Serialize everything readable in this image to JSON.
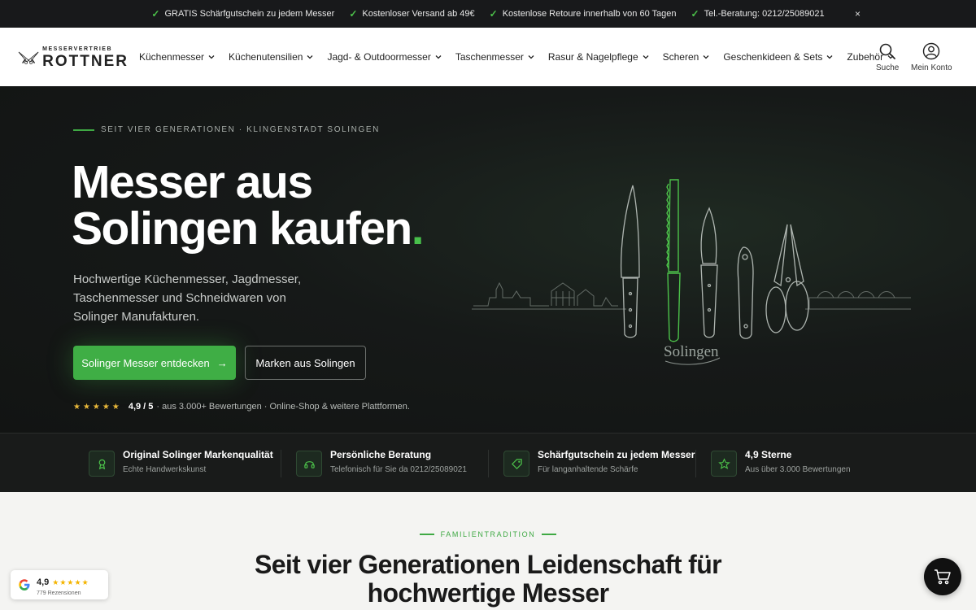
{
  "topbar": {
    "items": [
      "GRATIS Schärfgutschein zu jedem Messer",
      "Kostenloser Versand ab 49€",
      "Kostenlose Retoure innerhalb von 60 Tagen",
      "Tel.-Beratung: 0212/25089021"
    ],
    "close_label": "×"
  },
  "logo": {
    "small": "MESSERVERTRIEB",
    "big": "ROTTNER"
  },
  "nav": [
    "Küchenmesser",
    "Küchenutensilien",
    "Jagd- & Outdoormesser",
    "Taschenmesser",
    "Rasur & Nagelpflege",
    "Scheren",
    "Geschenkideen & Sets",
    "Zubehör"
  ],
  "header_actions": {
    "search": "Suche",
    "account": "Mein Konto"
  },
  "hero": {
    "eyebrow": "SEIT VIER GENERATIONEN · KLINGENSTADT SOLINGEN",
    "title_line1": "Messer aus",
    "title_line2": "Solingen kaufen",
    "title_dot": ".",
    "subtitle": "Hochwertige Küchenmesser, Jagdmesser, Taschenmesser und Schneidwaren von Solinger Manufakturen.",
    "cta_primary": "Solinger Messer entdecken",
    "cta_primary_arrow": "→",
    "cta_secondary": "Marken aus Solingen",
    "rating_stars": "★★★★★",
    "rating_score": "4,9 / 5",
    "rating_text": "· aus 3.000+ Bewertungen · Online-Shop & weitere Plattformen.",
    "illustration_caption": "Solingen"
  },
  "usps": [
    {
      "icon": "award-icon",
      "title": "Original Solinger Markenqualität",
      "desc": "Echte Handwerkskunst"
    },
    {
      "icon": "headset-icon",
      "title": "Persönliche Beratung",
      "desc": "Telefonisch für Sie da 0212/25089021"
    },
    {
      "icon": "tag-icon",
      "title": "Schärfgutschein zu jedem Messer",
      "desc": "Für langanhaltende Schärfe"
    },
    {
      "icon": "star-icon",
      "title": "4,9 Sterne",
      "desc": "Aus über 3.000 Bewertungen"
    }
  ],
  "section": {
    "eyebrow": "FAMILIENTRADITION",
    "title_line1": "Seit vier Generationen Leidenschaft für",
    "title_line2": "hochwertige Messer"
  },
  "google_badge": {
    "score": "4,9",
    "stars": "★★★★★",
    "count": "779 Rezensionen"
  },
  "colors": {
    "accent": "#3fae45",
    "dark": "#161918",
    "star": "#e8b83a"
  }
}
